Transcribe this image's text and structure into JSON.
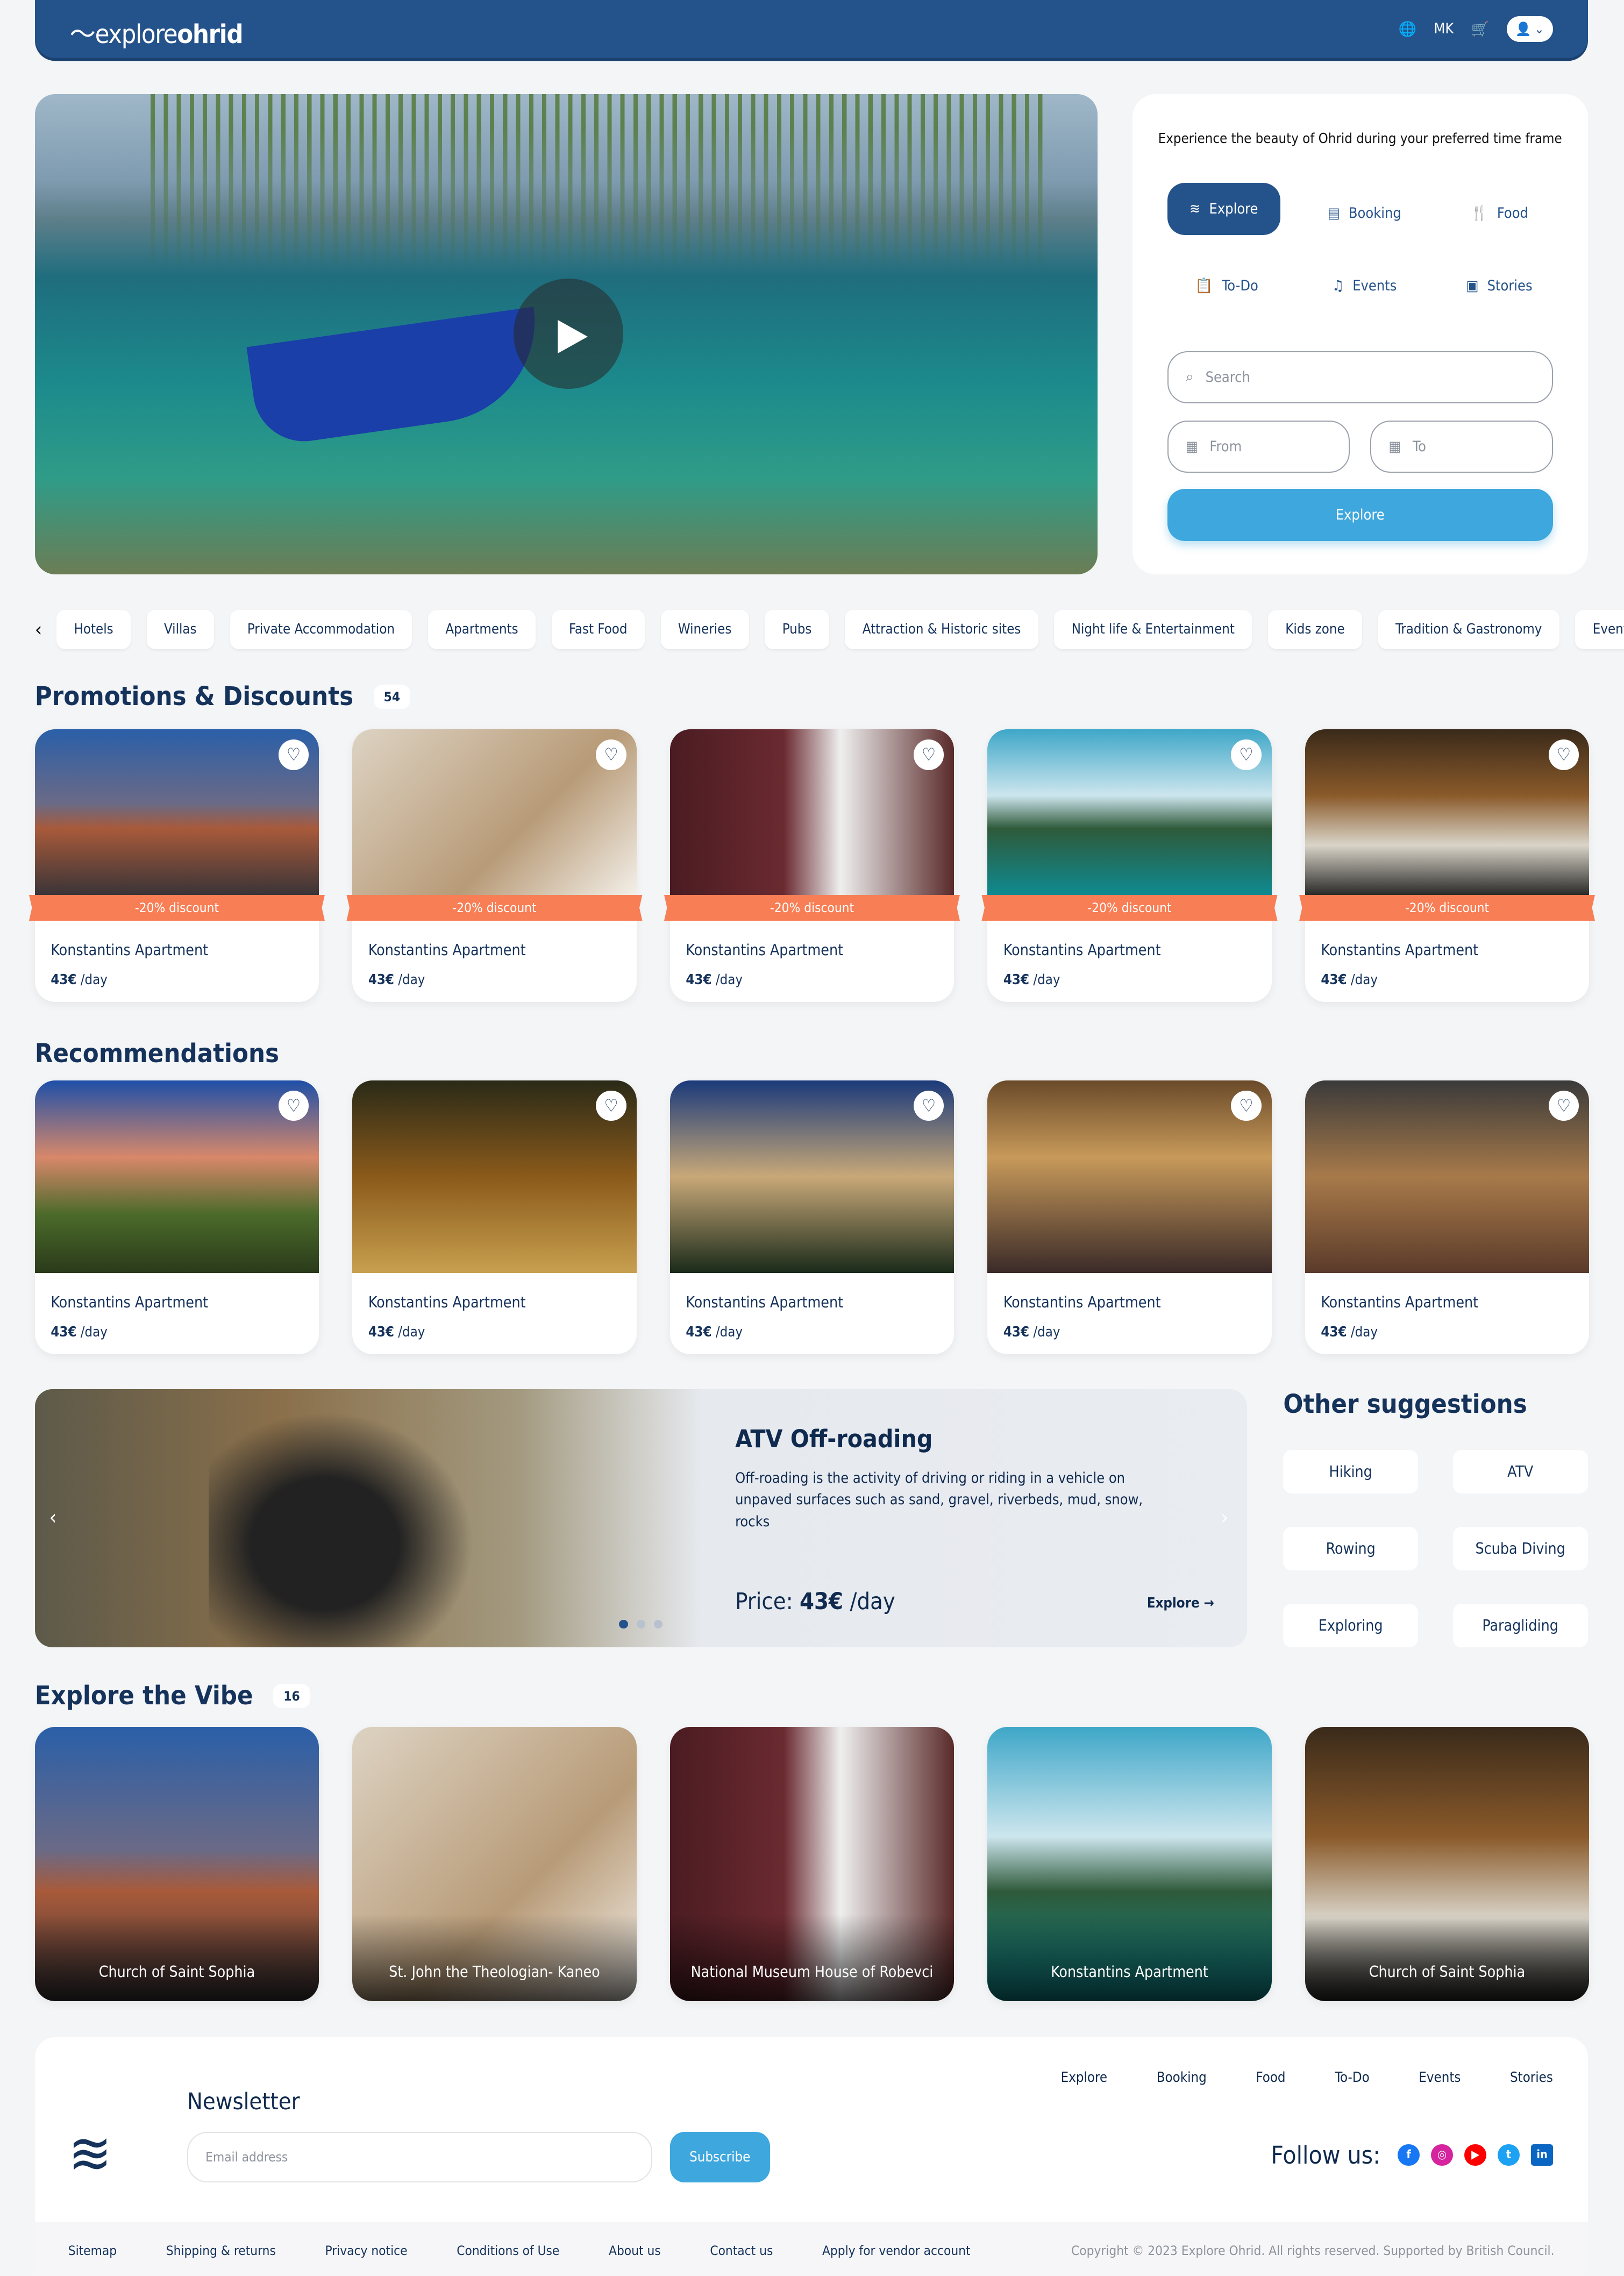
{
  "header": {
    "logo_light": "explore",
    "logo_bold": "ohrid",
    "language": "MK",
    "icons": [
      "globe-icon",
      "cart-icon",
      "user-icon",
      "chevron-down-icon"
    ]
  },
  "hero": {
    "video": "play-icon"
  },
  "panel": {
    "title": "Experience the beauty of Ohrid during your preferred time frame",
    "tabs": [
      {
        "label": "Explore",
        "icon": "explore-logo-icon",
        "active": true
      },
      {
        "label": "Booking",
        "icon": "calendar-icon"
      },
      {
        "label": "Food",
        "icon": "cutlery-icon"
      },
      {
        "label": "To-Do",
        "icon": "clipboard-icon"
      },
      {
        "label": "Events",
        "icon": "music-note-icon"
      },
      {
        "label": "Stories",
        "icon": "newspaper-icon"
      }
    ],
    "search_placeholder": "Search",
    "from_placeholder": "From",
    "to_placeholder": "To",
    "explore_button": "Explore"
  },
  "categories": [
    "Hotels",
    "Villas",
    "Private Accommodation",
    "Apartments",
    "Fast Food",
    "Wineries",
    "Pubs",
    "Attraction & Historic sites",
    "Night life & Entertainment",
    "Kids zone",
    "Tradition & Gastronomy",
    "Events"
  ],
  "promotions": {
    "title": "Promotions & Discounts",
    "count": "54",
    "items": [
      {
        "name": "Konstantins Apartment",
        "price": "43€",
        "unit": "/day",
        "discount": "-20% discount"
      },
      {
        "name": "Konstantins Apartment",
        "price": "43€",
        "unit": "/day",
        "discount": "-20% discount"
      },
      {
        "name": "Konstantins Apartment",
        "price": "43€",
        "unit": "/day",
        "discount": "-20% discount"
      },
      {
        "name": "Konstantins Apartment",
        "price": "43€",
        "unit": "/day",
        "discount": "-20% discount"
      },
      {
        "name": "Konstantins Apartment",
        "price": "43€",
        "unit": "/day",
        "discount": "-20% discount"
      }
    ]
  },
  "recommendations": {
    "title": "Recommendations",
    "items": [
      {
        "name": "Konstantins Apartment",
        "price": "43€",
        "unit": "/day"
      },
      {
        "name": "Konstantins Apartment",
        "price": "43€",
        "unit": "/day"
      },
      {
        "name": "Konstantins Apartment",
        "price": "43€",
        "unit": "/day"
      },
      {
        "name": "Konstantins Apartment",
        "price": "43€",
        "unit": "/day"
      },
      {
        "name": "Konstantins Apartment",
        "price": "43€",
        "unit": "/day"
      }
    ]
  },
  "featured": {
    "title": "ATV Off-roading",
    "description": "Off-roading is the activity of driving or riding in a vehicle on unpaved surfaces such as sand, gravel, riverbeds, mud, snow, rocks",
    "price_label": "Price:",
    "price": "43€",
    "unit": "/day",
    "explore": "Explore",
    "slides": 3,
    "active_slide": 1
  },
  "suggestions": {
    "title": "Other suggestions",
    "items": [
      "Hiking",
      "ATV",
      "Rowing",
      "Scuba Diving",
      "Exploring",
      "Paragliding"
    ]
  },
  "vibe": {
    "title": "Explore the Vibe",
    "count": "16",
    "items": [
      "Church of Saint Sophia",
      "St. John the Theologian- Kaneo",
      "National Museum House of Robevci",
      "Konstantins Apartment",
      "Church of Saint Sophia"
    ]
  },
  "footer": {
    "nav": [
      "Explore",
      "Booking",
      "Food",
      "To-Do",
      "Events",
      "Stories"
    ],
    "newsletter_title": "Newsletter",
    "email_placeholder": "Email address",
    "subscribe": "Subscribe",
    "follow": "Follow us:",
    "social": [
      {
        "name": "facebook",
        "color": "#1877f2"
      },
      {
        "name": "instagram",
        "color": "#d6249f"
      },
      {
        "name": "youtube",
        "color": "#ff0000"
      },
      {
        "name": "twitter",
        "color": "#1da1f2"
      },
      {
        "name": "linkedin",
        "color": "#0a66c2"
      }
    ],
    "links": [
      "Sitemap",
      "Shipping & returns",
      "Privacy notice",
      "Conditions of Use",
      "About us",
      "Contact us",
      "Apply for vendor account"
    ],
    "copyright": "Copyright © 2023 Explore Ohrid. All rights reserved. Supported by British Council."
  },
  "colors": {
    "primary": "#24528a",
    "accent": "#3ea7de",
    "discount": "#f77e55"
  }
}
